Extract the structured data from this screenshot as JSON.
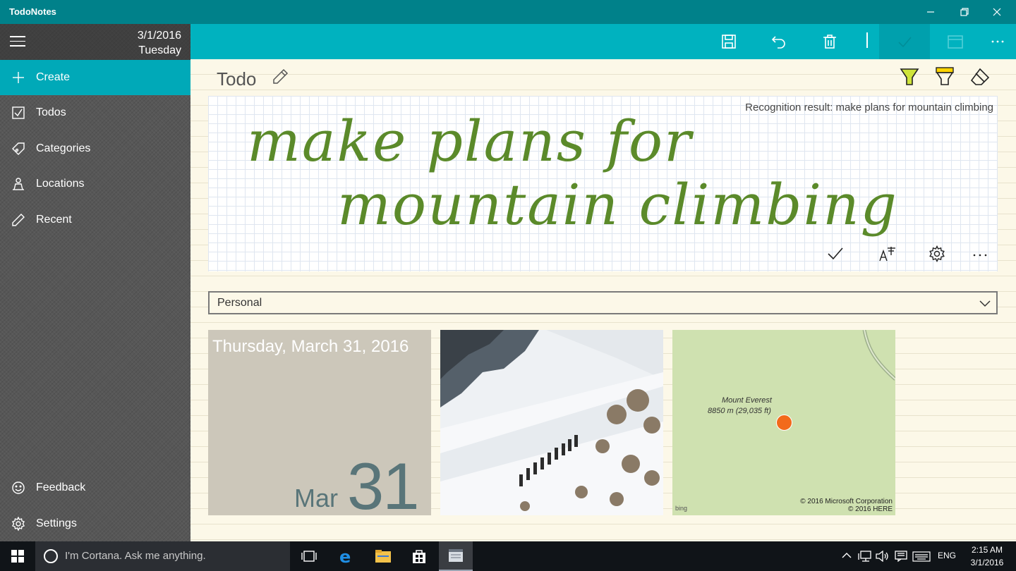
{
  "window": {
    "title": "TodoNotes"
  },
  "sidebar": {
    "date": "3/1/2016",
    "weekday": "Tuesday",
    "items": [
      {
        "label": "Create",
        "icon": "plus-icon"
      },
      {
        "label": "Todos",
        "icon": "checkbox-icon"
      },
      {
        "label": "Categories",
        "icon": "tag-icon"
      },
      {
        "label": "Locations",
        "icon": "person-location-icon"
      },
      {
        "label": "Recent",
        "icon": "pencil-icon"
      }
    ],
    "bottom_items": [
      {
        "label": "Feedback",
        "icon": "smiley-icon"
      },
      {
        "label": "Settings",
        "icon": "gear-icon"
      }
    ]
  },
  "appbar": {
    "buttons": [
      "save-icon",
      "undo-icon",
      "delete-icon",
      "check-icon",
      "calendar-icon",
      "more-icon"
    ]
  },
  "note": {
    "title": "Todo",
    "recognition": "Recognition result: make plans for mountain climbing",
    "ink_line1": "make plans for",
    "ink_line2": "mountain climbing",
    "ink_color": "#5b8a2a",
    "category": "Personal"
  },
  "date_tile": {
    "long_date": "Thursday, March 31, 2016",
    "month": "Mar",
    "day": "31"
  },
  "map_tile": {
    "place": "Mount Everest",
    "elevation": "8850 m (29,035 ft)",
    "copyright1": "© 2016 Microsoft Corporation",
    "copyright2": "© 2016 HERE",
    "brand": "bing"
  },
  "taskbar": {
    "cortana": "I'm Cortana. Ask me anything.",
    "lang": "ENG",
    "time": "2:15 AM",
    "date": "3/1/2016"
  },
  "colors": {
    "titlebar": "#00818a",
    "appbar": "#00b2bf",
    "accent": "#00a9b8",
    "map_pin": "#f26a1b"
  }
}
